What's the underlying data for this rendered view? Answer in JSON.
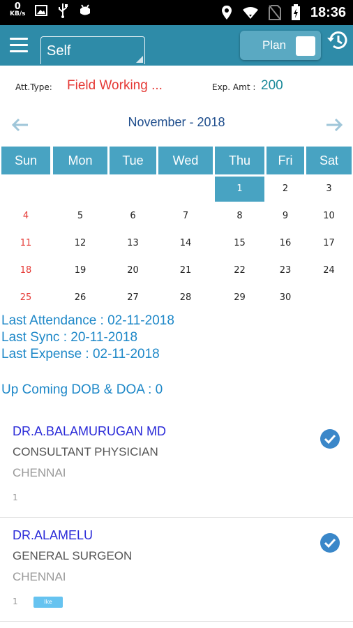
{
  "status_bar": {
    "net_speed": "0",
    "net_unit": "KB/s",
    "time": "18:36"
  },
  "app_bar": {
    "selector_value": "Self",
    "plan_label": "Plan"
  },
  "attendance": {
    "type_label": "Att.Type:",
    "type_value": "Field Working ...",
    "exp_label": "Exp. Amt :",
    "exp_value": "200"
  },
  "calendar": {
    "month_title": "November - 2018",
    "weekdays": [
      "Sun",
      "Mon",
      "Tue",
      "Wed",
      "Thu",
      "Fri",
      "Sat"
    ],
    "selected_day": "1",
    "weeks": [
      [
        "",
        "",
        "",
        "",
        "1",
        "2",
        "3"
      ],
      [
        "4",
        "5",
        "6",
        "7",
        "8",
        "9",
        "10"
      ],
      [
        "11",
        "12",
        "13",
        "14",
        "15",
        "16",
        "17"
      ],
      [
        "18",
        "19",
        "20",
        "21",
        "22",
        "23",
        "24"
      ],
      [
        "25",
        "26",
        "27",
        "28",
        "29",
        "30",
        ""
      ]
    ]
  },
  "summary": {
    "last_attendance": "Last Attendance : 02-11-2018",
    "last_sync": "Last Sync : 20-11-2018",
    "last_expense": "Last Expense : 02-11-2018",
    "upcoming": "Up Coming DOB & DOA : 0"
  },
  "doctors": [
    {
      "name": "DR.A.BALAMURUGAN MD",
      "specialty": "CONSULTANT PHYSICIAN",
      "city": "CHENNAI",
      "count": "1",
      "tag": ""
    },
    {
      "name": "DR.ALAMELU",
      "specialty": "GENERAL SURGEON",
      "city": "CHENNAI",
      "count": "1",
      "tag": "Ike"
    }
  ],
  "colors": {
    "primary": "#2e8ba8",
    "header_cell": "#48a3c2",
    "sunday": "#e53935",
    "link": "#1e88c8",
    "doctor_name": "#2a2ad8"
  }
}
